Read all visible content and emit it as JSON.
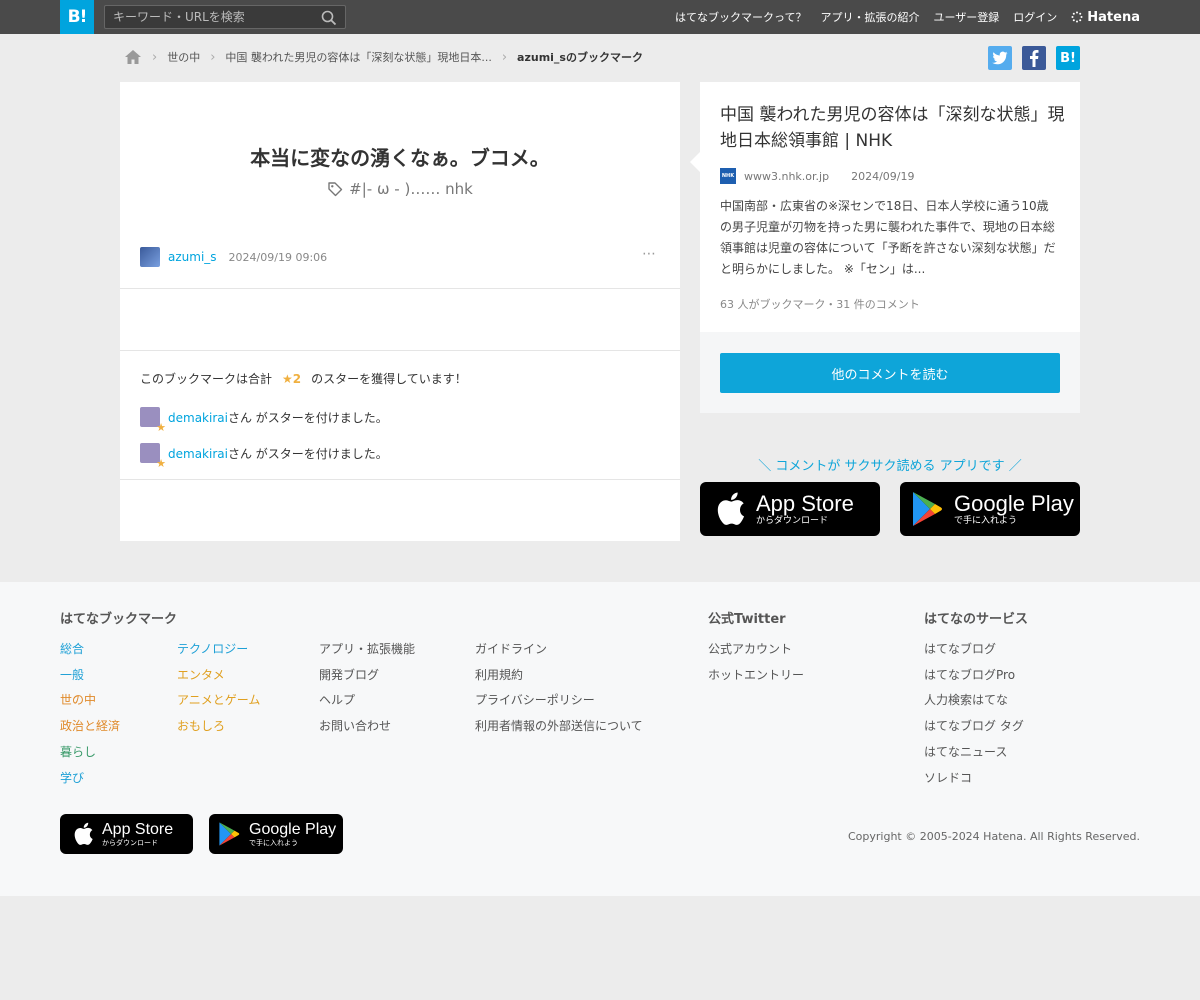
{
  "header": {
    "logo": "B!",
    "search_placeholder": "キーワード・URLを検索",
    "nav": [
      "はてなブックマークって？",
      "アプリ・拡張の紹介",
      "ユーザー登録",
      "ログイン"
    ],
    "brand": "Hatena"
  },
  "breadcrumb": {
    "items": [
      "世の中",
      "中国 襲われた男児の容体は「深刻な状態」現地日本..."
    ],
    "current": "azumi_sのブックマーク"
  },
  "share": {
    "twitter_color": "#55acee",
    "facebook_color": "#3b5998",
    "hatena_color": "#00a4de",
    "hatena_label": "B!"
  },
  "bookmark": {
    "comment": "本当に変なの湧くなぁ。ブコメ。",
    "tags": "#|- ω - )……  nhk",
    "user": "azumi_s",
    "date": "2024/09/19 09:06",
    "more": "⋯"
  },
  "stars": {
    "prefix": "このブックマークは合計",
    "count": "★2",
    "suffix": "のスターを獲得しています！",
    "entries": [
      {
        "user": "demakirai",
        "text": "さん がスターを付けました。"
      },
      {
        "user": "demakirai",
        "text": "さん がスターを付けました。"
      }
    ]
  },
  "entry": {
    "title": "中国 襲われた男児の容体は「深刻な状態」現地日本総領事館 | NHK",
    "favicon": "NHK",
    "domain": "www3.nhk.or.jp",
    "date": "2024/09/19",
    "description": "中国南部・広東省の※深センで18日、日本人学校に通う10歳の男子児童が刃物を持った男に襲われた事件で、現地の日本総領事館は児童の容体について「予断を許さない深刻な状態」だと明らかにしました。 ※「セン」は...",
    "stats": "63 人がブックマーク・31 件のコメント",
    "read_button": "他のコメントを読む"
  },
  "app_promo": {
    "text": "＼ コメントが サクサク読める アプリです ／",
    "app_store": {
      "main": "App Store",
      "sub": "からダウンロード"
    },
    "google_play": {
      "main": "Google Play",
      "sub": "で手に入れよう"
    }
  },
  "footer": {
    "sections": {
      "bookmark": "はてなブックマーク",
      "twitter": "公式Twitter",
      "services": "はてなのサービス"
    },
    "categories_col1": [
      {
        "label": "総合",
        "color": "#1ea0d6"
      },
      {
        "label": "一般",
        "color": "#1ea0d6"
      },
      {
        "label": "世の中",
        "color": "#e08a2a"
      },
      {
        "label": "政治と経済",
        "color": "#e08a2a"
      },
      {
        "label": "暮らし",
        "color": "#3a9a6a"
      },
      {
        "label": "学び",
        "color": "#1ea0d6"
      }
    ],
    "categories_col2": [
      {
        "label": "テクノロジー",
        "color": "#1ea0d6"
      },
      {
        "label": "エンタメ",
        "color": "#e0a020"
      },
      {
        "label": "アニメとゲーム",
        "color": "#e0a020"
      },
      {
        "label": "おもしろ",
        "color": "#e0a020"
      }
    ],
    "links_col3": [
      "アプリ・拡張機能",
      "開発ブログ",
      "ヘルプ",
      "お問い合わせ"
    ],
    "links_col4": [
      "ガイドライン",
      "利用規約",
      "プライバシーポリシー",
      "利用者情報の外部送信について"
    ],
    "twitter_links": [
      "公式アカウント",
      "ホットエントリー"
    ],
    "service_links": [
      "はてなブログ",
      "はてなブログPro",
      "人力検索はてな",
      "はてなブログ タグ",
      "はてなニュース",
      "ソレドコ"
    ],
    "copyright": "Copyright © 2005-2024 Hatena. All Rights Reserved."
  }
}
